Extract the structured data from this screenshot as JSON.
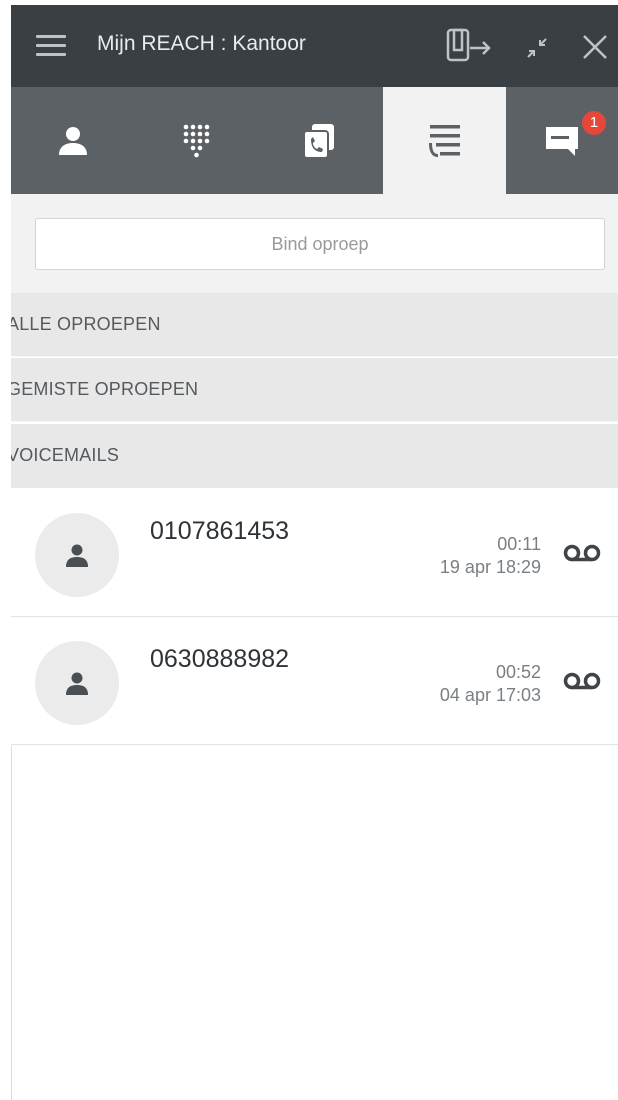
{
  "titlebar": {
    "title": "Mijn REACH : Kantoor",
    "icons": [
      "menu-icon",
      "transfer-device-icon",
      "minimize-icon",
      "close-icon"
    ]
  },
  "tabs": [
    {
      "name": "contacts",
      "icon": "person-icon",
      "active": false
    },
    {
      "name": "dialpad",
      "icon": "dialpad-icon",
      "active": false
    },
    {
      "name": "calls",
      "icon": "phone-copy-icon",
      "active": false
    },
    {
      "name": "history",
      "icon": "call-history-icon",
      "active": true
    },
    {
      "name": "messages",
      "icon": "chat-icon",
      "active": false,
      "badge": "1"
    }
  ],
  "search": {
    "placeholder": "Bind oproep",
    "value": ""
  },
  "filters": [
    {
      "label": "ALLE OPROEPEN"
    },
    {
      "label": "GEMISTE OPROEPEN"
    },
    {
      "label": "VOICEMAILS"
    }
  ],
  "calls": [
    {
      "number": "0107861453",
      "duration": "00:11",
      "datetime": "19 apr 18:29",
      "icon": "voicemail-icon"
    },
    {
      "number": "0630888982",
      "duration": "00:52",
      "datetime": "04 apr 17:03",
      "icon": "voicemail-icon"
    }
  ],
  "colors": {
    "titlebar": "#3a3f44",
    "tabbar": "#5c6166",
    "active_tab": "#f2f2f2",
    "badge": "#e5483b"
  }
}
